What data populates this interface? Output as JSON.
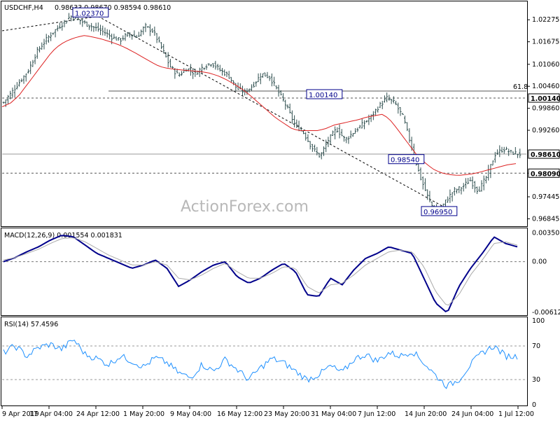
{
  "colors": {
    "candle": "#2f4f4f",
    "ma": "#dd2222",
    "macd_line": "#00008b",
    "macd_signal": "#aaaaaa",
    "rsi": "#1e90ff",
    "callout": "#00008b",
    "grid_dashed": "#555555"
  },
  "header": {
    "symbol_timeframe": "USDCHF,H4",
    "ohlc": "0.98633 0.98670 0.98594 0.98610"
  },
  "watermark": "ActionForex.com",
  "chart_data": [
    {
      "type": "candlestick",
      "panel": "price",
      "y_ticks": [
        "1.02275",
        "1.01675",
        "1.01060",
        "1.00460",
        "0.99860",
        "0.99260",
        "0.98650",
        "0.98090",
        "0.97445",
        "0.96845"
      ],
      "ylim": [
        0.967,
        1.027
      ],
      "current_price_label": "0.98610",
      "current_price": 0.9861,
      "levels": [
        {
          "label": "1.00140",
          "value": 1.0014,
          "style": "dashed"
        },
        {
          "label": "0.98090",
          "value": 0.9809,
          "style": "dashed"
        },
        {
          "label": "61.8",
          "value": 1.0033,
          "style": "solid"
        }
      ],
      "annotations": [
        {
          "label": "1.02370",
          "value": 1.0237
        },
        {
          "label": "1.00140",
          "value": 1.0014
        },
        {
          "label": "0.98540",
          "value": 0.9854
        },
        {
          "label": "0.96950",
          "value": 0.9695
        }
      ],
      "close_path": [
        1.0002,
        1.003,
        1.006,
        1.009,
        1.014,
        1.017,
        1.0195,
        1.0215,
        1.0237,
        1.0228,
        1.0215,
        1.0205,
        1.0195,
        1.018,
        1.0172,
        1.019,
        1.018,
        1.021,
        1.0195,
        1.015,
        1.01,
        1.0075,
        1.0095,
        1.008,
        1.01,
        1.011,
        1.009,
        1.0075,
        1.004,
        1.003,
        1.005,
        1.008,
        1.007,
        1.003,
        0.999,
        0.994,
        0.992,
        0.988,
        0.9854,
        0.99,
        0.993,
        0.99,
        0.992,
        0.994,
        0.996,
        0.999,
        1.0014,
        1.0,
        0.996,
        0.988,
        0.98,
        0.974,
        0.9695,
        0.973,
        0.976,
        0.977,
        0.979,
        0.976,
        0.98,
        0.986,
        0.9875,
        0.9865,
        0.9861
      ],
      "ma_path": [
        0.999,
        1.0,
        1.002,
        1.005,
        1.008,
        1.011,
        1.014,
        1.016,
        1.0172,
        1.018,
        1.0185,
        1.018,
        1.0175,
        1.0168,
        1.016,
        1.015,
        1.0138,
        1.0125,
        1.0112,
        1.01,
        1.0095,
        1.0092,
        1.009,
        1.0088,
        1.0086,
        1.0082,
        1.0075,
        1.0065,
        1.0052,
        1.0038,
        1.002,
        1.0,
        0.998,
        0.996,
        0.9945,
        0.993,
        0.9925,
        0.9925,
        0.9925,
        0.993,
        0.994,
        0.9945,
        0.995,
        0.9955,
        0.9962,
        0.9966,
        0.997,
        0.995,
        0.992,
        0.989,
        0.986,
        0.9838,
        0.982,
        0.981,
        0.9805,
        0.9803,
        0.9805,
        0.9808,
        0.9814,
        0.982,
        0.9826,
        0.9832,
        0.9835
      ]
    },
    {
      "type": "line",
      "panel": "macd",
      "title": "MACD(12,26,9) 0.001554 0.001831",
      "y_ticks": [
        "0.003508",
        "0.00",
        "-0.006121"
      ],
      "ylim": [
        -0.0063,
        0.0037
      ],
      "series": [
        {
          "role": "macd",
          "values": [
            0.0,
            0.0005,
            0.0012,
            0.0018,
            0.0026,
            0.0032,
            0.003,
            0.002,
            0.001,
            0.0004,
            -0.0002,
            -0.0008,
            -0.0004,
            0.0002,
            -0.0008,
            -0.003,
            -0.0022,
            -0.0012,
            -0.0004,
            0.0,
            -0.0018,
            -0.0026,
            -0.002,
            -0.001,
            -0.0002,
            -0.0012,
            -0.004,
            -0.0042,
            -0.002,
            -0.0028,
            -0.001,
            0.0004,
            0.001,
            0.0018,
            0.0014,
            0.001,
            -0.002,
            -0.005,
            -0.0062,
            -0.003,
            -0.0008,
            0.001,
            0.003,
            0.0022,
            0.0018
          ]
        },
        {
          "role": "signal",
          "values": [
            0.0002,
            0.0005,
            0.001,
            0.0015,
            0.0022,
            0.0028,
            0.0029,
            0.0024,
            0.0016,
            0.0008,
            0.0002,
            -0.0004,
            -0.0004,
            0.0,
            -0.0004,
            -0.002,
            -0.0022,
            -0.0016,
            -0.0008,
            -0.0002,
            -0.0012,
            -0.002,
            -0.002,
            -0.0014,
            -0.0006,
            -0.0008,
            -0.003,
            -0.0038,
            -0.0028,
            -0.0026,
            -0.0016,
            -0.0004,
            0.0004,
            0.0012,
            0.0014,
            0.0012,
            -0.0006,
            -0.0036,
            -0.0054,
            -0.004,
            -0.0016,
            0.0002,
            0.0022,
            0.0024,
            0.002
          ]
        }
      ]
    },
    {
      "type": "line",
      "panel": "rsi",
      "title": "RSI(14) 57.4596",
      "y_ticks": [
        "100",
        "70",
        "30",
        "0"
      ],
      "ylim": [
        0,
        100
      ],
      "levels": [
        70,
        30
      ],
      "series": [
        {
          "role": "rsi",
          "values": [
            62,
            70,
            58,
            68,
            72,
            66,
            78,
            60,
            55,
            48,
            58,
            52,
            45,
            56,
            50,
            38,
            32,
            48,
            40,
            54,
            42,
            30,
            44,
            55,
            50,
            40,
            30,
            36,
            46,
            38,
            54,
            60,
            52,
            62,
            58,
            64,
            50,
            35,
            22,
            30,
            48,
            62,
            70,
            58,
            57.5
          ]
        }
      ]
    }
  ],
  "x_ticks": [
    "9 Apr 2019",
    "17 Apr 04:00",
    "24 Apr 12:00",
    "1 May 20:00",
    "9 May 04:00",
    "16 May 12:00",
    "23 May 20:00",
    "31 May 04:00",
    "7 Jun 12:00",
    "14 Jun 20:00",
    "24 Jun 04:00",
    "1 Jul 12:00"
  ]
}
